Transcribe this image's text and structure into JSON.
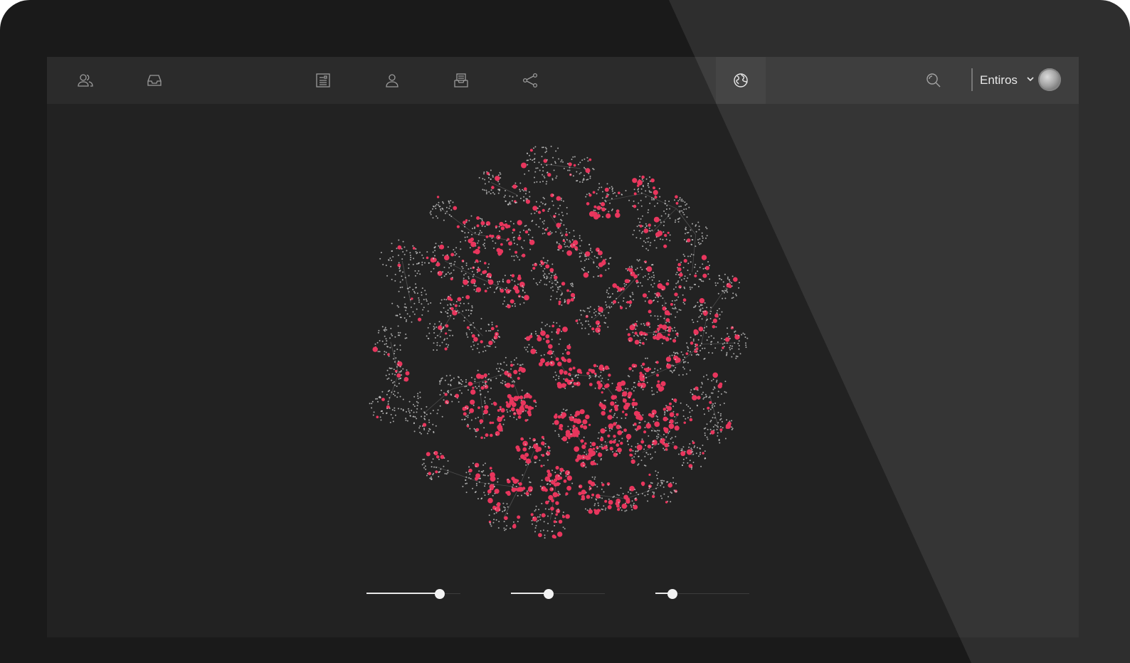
{
  "window": {
    "title": ""
  },
  "topbar": {
    "left_icons": [
      "people-icon",
      "inbox-icon"
    ],
    "center_icons": [
      "document-icon",
      "user-icon",
      "archive-icon",
      "share-icon"
    ],
    "active_icon": "globe-icon",
    "user": {
      "name": "Entiros",
      "dropdown_icon": "chevron-down-icon"
    }
  },
  "graph": {
    "style": "clustered network graph",
    "node_color": "#c9c9c9",
    "highlight_color": "#e8365d",
    "background": "#222222"
  },
  "sliders": [
    {
      "value": 0.78
    },
    {
      "value": 0.4
    },
    {
      "value": 0.18
    }
  ],
  "colors": {
    "accent": "#e8365d",
    "bezel": "#1a1a1a",
    "screen": "#222222",
    "topbar": "#2b2b2b"
  }
}
